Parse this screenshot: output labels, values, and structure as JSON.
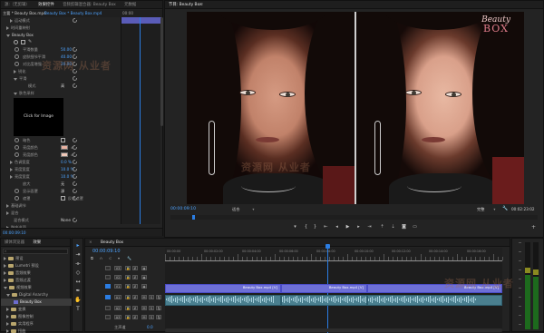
{
  "effect_controls": {
    "tabs": [
      "源:（无剪辑）",
      "效果控件",
      "音频剪辑混合器: Beauty Box",
      "元数据"
    ],
    "active_tab": 1,
    "source_dropdown": "主要 * Beauty Box.mp4",
    "sequence_dropdown": "Beauty Box * Beauty Box.mp4",
    "timecode": "00:00",
    "rows": [
      {
        "label": "运动模式",
        "value": ""
      },
      {
        "label": "时间重映射",
        "value": ""
      },
      {
        "label": "Beauty Box",
        "value": ""
      },
      {
        "label": "",
        "value": ""
      },
      {
        "label": "平滑数量",
        "value": "50.00"
      },
      {
        "label": "皮肤细节平滑",
        "value": "40.00"
      },
      {
        "label": "对比度增强",
        "value": "20.00"
      },
      {
        "label": "锐化",
        "value": ""
      },
      {
        "label": "平滑",
        "value": ""
      },
      {
        "label": "模式",
        "value": "高"
      },
      {
        "label": "肤色采样",
        "value": ""
      }
    ],
    "click_for_image": "Click for Image",
    "rows2": [
      {
        "label": "暗色",
        "value": ""
      },
      {
        "label": "亮度颜色",
        "value": ""
      },
      {
        "label": "亮度颜色",
        "value": ""
      },
      {
        "label": "色调宽度",
        "value": "0.0 %"
      },
      {
        "label": "亮度宽度",
        "value": "10.0 %"
      },
      {
        "label": "亮度宽度",
        "value": "10.0 %"
      },
      {
        "label": "放大",
        "value": "无"
      },
      {
        "label": "显示面罩",
        "value": "源"
      },
      {
        "label": "遮罩",
        "value": "反转遮罩"
      },
      {
        "label": "基础调节",
        "value": ""
      },
      {
        "label": "混合",
        "value": ""
      },
      {
        "label": "混合模式",
        "value": "None"
      },
      {
        "label": "融合选项",
        "value": ""
      }
    ],
    "bottom_timecode": "00:00:09:10"
  },
  "program": {
    "tab_label": "节目: Beauty Box",
    "timecode": "00:00:09:10",
    "fit": "适合",
    "quality": "完整",
    "duration": "00:02:23:02",
    "logo_line1": "Beauty",
    "logo_line2": "BOX"
  },
  "project": {
    "tabs": [
      "媒体浏览器",
      "效果"
    ],
    "active_tab": 1,
    "items": [
      "预设",
      "Lumetri 预设",
      "音频效果",
      "音频过渡",
      "视频效果",
      "Digital Anarchy",
      "Beauty Box",
      "变换",
      "图像控制",
      "实用程序",
      "扭曲",
      "时间",
      "杂色与颗粒"
    ]
  },
  "timeline": {
    "tab_label": "Beauty Box",
    "timecode": "00:00:09:10",
    "ruler_labels": [
      "00:00:00",
      "00:00:02:00",
      "00:00:04:00",
      "00:00:06:00",
      "00:00:08:00",
      "00:00:10:00",
      "00:00:12:00",
      "00:00:14:00",
      "00:00:16:00"
    ],
    "tracks": [
      "V3",
      "V2",
      "V1",
      "A1",
      "A2",
      "A3"
    ],
    "master_label": "主声道",
    "master_value": "0.0",
    "clips": [
      "Beauty Box.mp4 [V]",
      "Beauty Box.mp4 [V]",
      "Beauty Box.mp4 [V]"
    ],
    "playhead_fraction": 0.48
  },
  "watermark": "资源网 从业者",
  "colors": {
    "accent": "#2b7de2",
    "video_clip": "#6d6fd6",
    "audio_clip": "#4a7f8f",
    "timecode": "#4da3ff"
  }
}
